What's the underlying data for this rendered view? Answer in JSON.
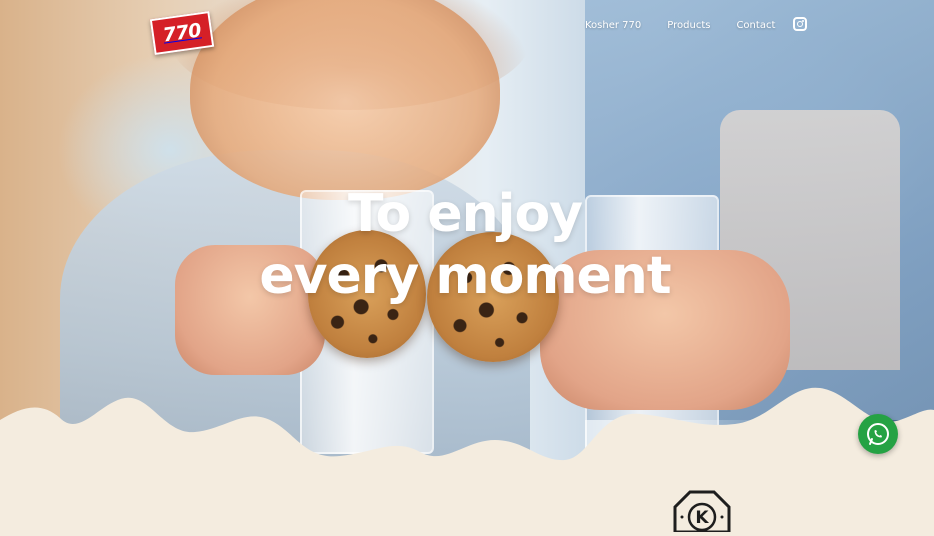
{
  "header": {
    "logo_text": "770",
    "nav": [
      {
        "label": "Kosher 770"
      },
      {
        "label": "Products"
      },
      {
        "label": "Contact"
      }
    ],
    "social_icon": "instagram-icon"
  },
  "hero": {
    "headline_line1": "To enjoy",
    "headline_line2": "every moment"
  },
  "floating": {
    "whatsapp_icon": "whatsapp-icon"
  },
  "kosher_badge": {
    "letter": "K",
    "icon": "kosher-certification-icon"
  },
  "colors": {
    "background": "#f4ecdf",
    "logo_red": "#d52027",
    "whatsapp_green": "#25a244",
    "nav_text": "#ffffff"
  }
}
